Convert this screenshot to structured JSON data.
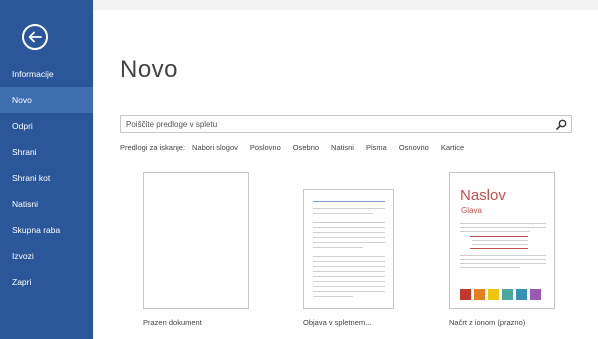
{
  "sidebar": {
    "back_label": "",
    "items": [
      {
        "label": "Informacije",
        "active": false
      },
      {
        "label": "Novo",
        "active": true
      },
      {
        "label": "Odpri",
        "active": false
      },
      {
        "label": "Shrani",
        "active": false
      },
      {
        "label": "Shrani kot",
        "active": false
      },
      {
        "label": "Natisni",
        "active": false
      },
      {
        "label": "Skupna raba",
        "active": false
      },
      {
        "label": "Izvozi",
        "active": false
      },
      {
        "label": "Zapri",
        "active": false
      }
    ]
  },
  "main": {
    "title": "Novo",
    "search": {
      "placeholder": "Poiščite predloge v spletu",
      "value": ""
    },
    "suggested_label": "Predlogi za iskanje:",
    "suggested": [
      "Nabori slogov",
      "Poslovno",
      "Osebno",
      "Natisni",
      "Pisma",
      "Osnovno",
      "Kartice"
    ],
    "templates": [
      {
        "name": "Prazen dokument"
      },
      {
        "name": "Objava v spletnem..."
      },
      {
        "name": "Načrt z ionom (prazno)",
        "heading": "Naslov",
        "subheading": "Glava"
      }
    ]
  },
  "colors": {
    "sidebar": "#2b579a",
    "sidebar_active": "#3e6db0",
    "accent_red": "#c0504d",
    "swatches": [
      "#c0392b",
      "#e67e22",
      "#f1c40f",
      "#4aa89c",
      "#3a8fb7",
      "#9b59b6"
    ]
  }
}
